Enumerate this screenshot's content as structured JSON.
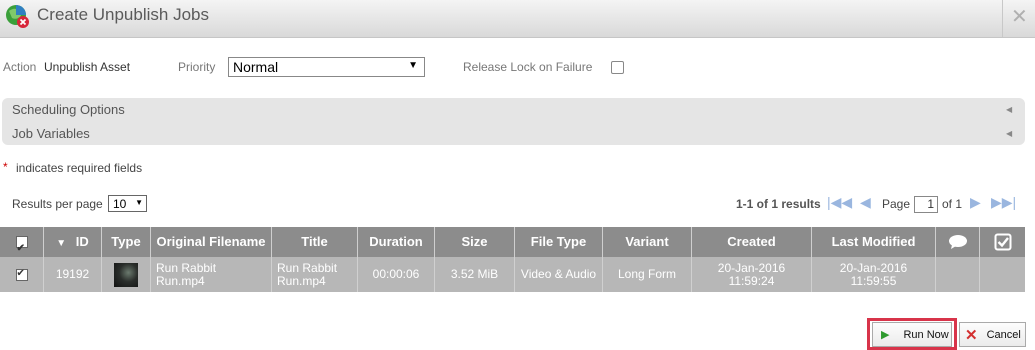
{
  "window": {
    "title": "Create Unpublish Jobs",
    "close_symbol": "✕"
  },
  "action": {
    "label": "Action",
    "value": "Unpublish Asset"
  },
  "priority": {
    "label": "Priority",
    "selected": "Normal"
  },
  "release_lock": {
    "label": "Release Lock on Failure",
    "checked": false
  },
  "sections": [
    {
      "label": "Scheduling Options"
    },
    {
      "label": "Job Variables"
    }
  ],
  "required_note": {
    "star": "*",
    "text": "indicates required fields"
  },
  "results_per_page": {
    "label": "Results per page",
    "value": "10"
  },
  "pagination": {
    "summary": "1-1 of 1 results",
    "page_label": "Page",
    "page_value": "1",
    "of_label": "of 1"
  },
  "table": {
    "headers": [
      "ID",
      "Type",
      "Original Filename",
      "Title",
      "Duration",
      "Size",
      "File Type",
      "Variant",
      "Created",
      "Last Modified"
    ],
    "sort_indicator": "▼",
    "row": {
      "id": "19192",
      "filename_line1": "Run Rabbit",
      "filename_line2": "Run.mp4",
      "title_line1": "Run Rabbit",
      "title_line2": "Run.mp4",
      "duration": "00:00:06",
      "size": "3.52 MiB",
      "file_type": "Video & Audio",
      "variant": "Long Form",
      "created_line1": "20-Jan-2016",
      "created_line2": "11:59:24",
      "modified_line1": "20-Jan-2016",
      "modified_line2": "11:59:55"
    }
  },
  "buttons": {
    "run_now": "Run Now",
    "cancel": "Cancel"
  },
  "colors": {
    "header_bg": "#8c8c8c",
    "row_bg": "#b7b7b7",
    "highlight": "#d8344a",
    "run_icon": "#2e9a2e",
    "cancel_icon": "#d32f2f"
  }
}
